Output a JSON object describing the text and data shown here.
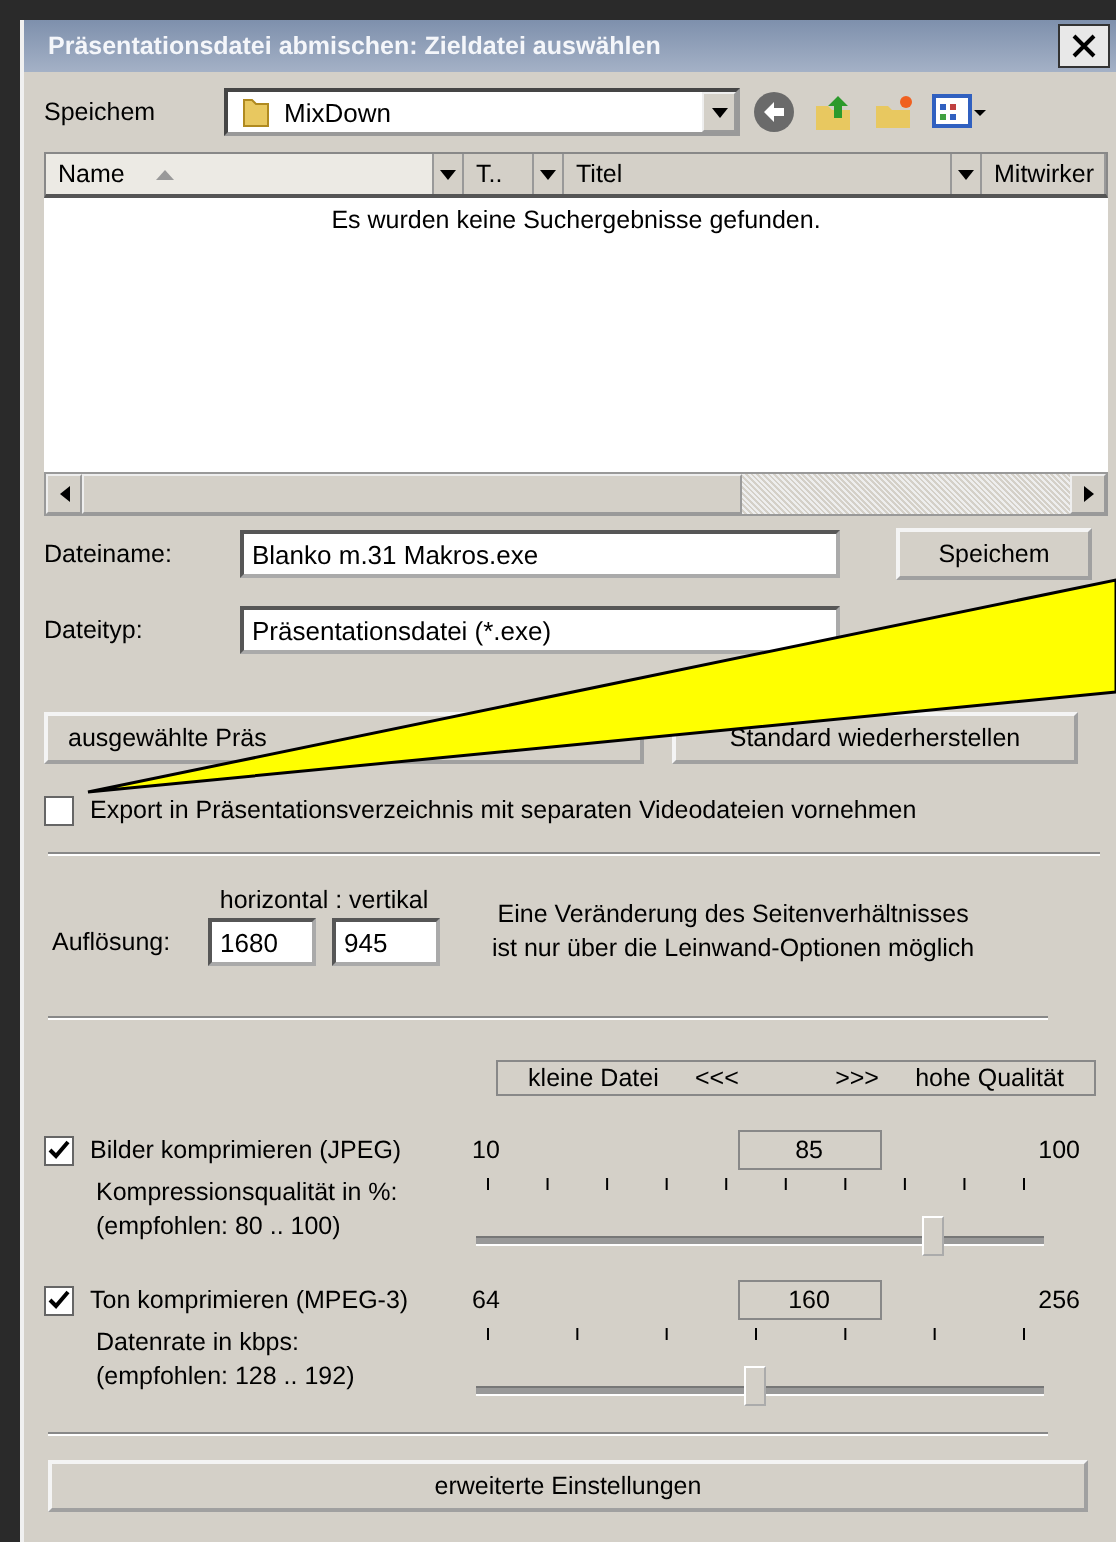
{
  "window": {
    "title": "Präsentationsdatei abmischen: Zieldatei auswählen"
  },
  "save_in": {
    "label": "Speichem",
    "value": "MixDown"
  },
  "file_list": {
    "columns": [
      {
        "label": "Name",
        "sorted": true,
        "kind": "wide"
      },
      {
        "label": "T..",
        "sorted": false,
        "kind": "narrow"
      },
      {
        "label": "Titel",
        "sorted": false,
        "kind": "wide"
      },
      {
        "label": "Mitwirker",
        "sorted": false,
        "kind": "last"
      }
    ],
    "empty_message": "Es wurden keine Suchergebnisse gefunden."
  },
  "file_name": {
    "label": "Dateiname:",
    "value": "Blanko m.31 Makros.exe"
  },
  "save_button": "Speichem",
  "file_type": {
    "label": "Dateityp:",
    "value": "Präsentationsdatei (*.exe)"
  },
  "buttons": [
    "ausgewählte Präs",
    "Standard wiederherstellen"
  ],
  "export_option": {
    "label": "Export in Präsentationsverzeichnis mit separaten Videodateien vornehmen",
    "checked": false
  },
  "resolution": {
    "label": "Auflösung:",
    "header": "horizontal : vertikal",
    "horizontal": "1680",
    "vertical": "945",
    "note": [
      "Eine Veränderung des Seitenverhältnisses",
      "ist nur über die Leinwand-Optionen möglich"
    ]
  },
  "quality_scale": {
    "small": "kleine Datei",
    "left_arrows": "<<<",
    "right_arrows": ">>>",
    "high": "hohe Qualität"
  },
  "compression": [
    {
      "kind": "image",
      "label": "Bilder komprimieren (JPEG)",
      "checked": true,
      "caption": "Kompressionsqualität in %:",
      "recommended": "(empfohlen: 80 .. 100)",
      "min": "10",
      "value": "85",
      "max": "100",
      "level": 0.833
    },
    {
      "kind": "audio",
      "label": "Ton komprimieren (MPEG-3)",
      "checked": true,
      "caption": "Datenrate in kbps:",
      "recommended": "(empfohlen: 128 .. 192)",
      "min": "64",
      "value": "160",
      "max": "256",
      "level": 0.5
    }
  ],
  "advanced_button": "erweiterte Einstellungen"
}
